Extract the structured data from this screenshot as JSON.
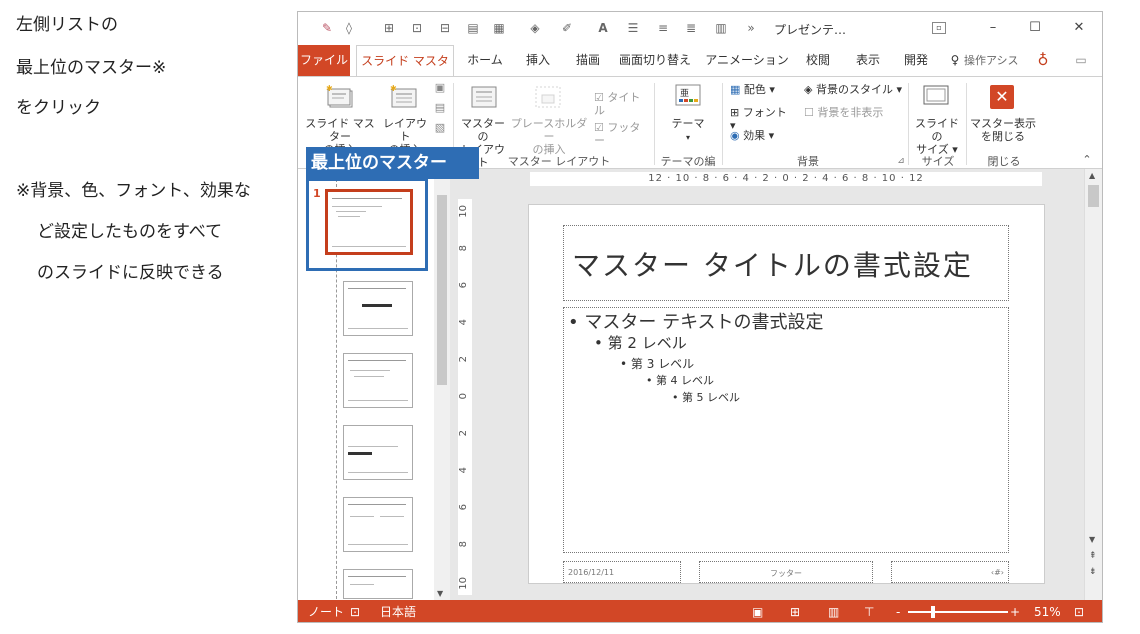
{
  "annotation": {
    "lines": [
      "左側リストの",
      "最上位のマスター※",
      "をクリック"
    ],
    "note_lines": [
      "※背景、色、フォント、効果な",
      "ど設定したものをすべて",
      "のスライドに反映できる"
    ]
  },
  "window": {
    "title": "プレゼンテ…",
    "more": "»"
  },
  "tabs": [
    "ファイル",
    "スライド マスター",
    "ホーム",
    "挿入",
    "描画",
    "画面切り替え",
    "アニメーション",
    "校閲",
    "表示",
    "開発"
  ],
  "tell_me": "操作アシス",
  "ribbon": {
    "insert_slide_master": [
      "スライド マスター",
      "の挿入"
    ],
    "insert_layout": [
      "レイアウト",
      "の挿入"
    ],
    "master_layout": [
      "マスターの",
      "レイアウト"
    ],
    "insert_placeholder": [
      "プレースホルダー",
      "の挿入"
    ],
    "title_check": "タイトル",
    "footer_check": "フッター",
    "theme": "テーマ",
    "colors": "配色",
    "fonts": "フォント",
    "effects": "効果",
    "background_styles": "背景のスタイル",
    "hide_background": "背景を非表示",
    "slide_size": [
      "スライドの",
      "サイズ"
    ],
    "close_master": [
      "マスター表示",
      "を閉じる"
    ],
    "groups": {
      "master_layout": "マスター レイアウト",
      "edit_theme": "テーマの編集",
      "background": "背景",
      "size": "サイズ",
      "close": "閉じる"
    }
  },
  "thumbnails": {
    "first_number": "1",
    "callout": "最上位のマスター"
  },
  "ruler": {
    "horizontal": "12 · 10 · 8 · 6 · 4 · 2 · 0 · 2 · 4 · 6 · 8 · 10 · 12",
    "vertical": [
      "10",
      "8",
      "6",
      "4",
      "2",
      "0",
      "2",
      "4",
      "6",
      "8",
      "10"
    ]
  },
  "slide": {
    "title": "マスター タイトルの書式設定",
    "level1": "マスター テキストの書式設定",
    "level2": "第 2 レベル",
    "level3": "第 3 レベル",
    "level4": "第 4 レベル",
    "level5": "第 5 レベル",
    "date": "2016/12/11",
    "footer": "フッター",
    "page": "‹#›"
  },
  "status": {
    "notes": "ノート",
    "language": "日本語",
    "zoom_minus": "-",
    "zoom_plus": "+",
    "zoom": "51%"
  },
  "colors": {
    "accent": "#d24726",
    "highlight": "#2e6db4"
  }
}
